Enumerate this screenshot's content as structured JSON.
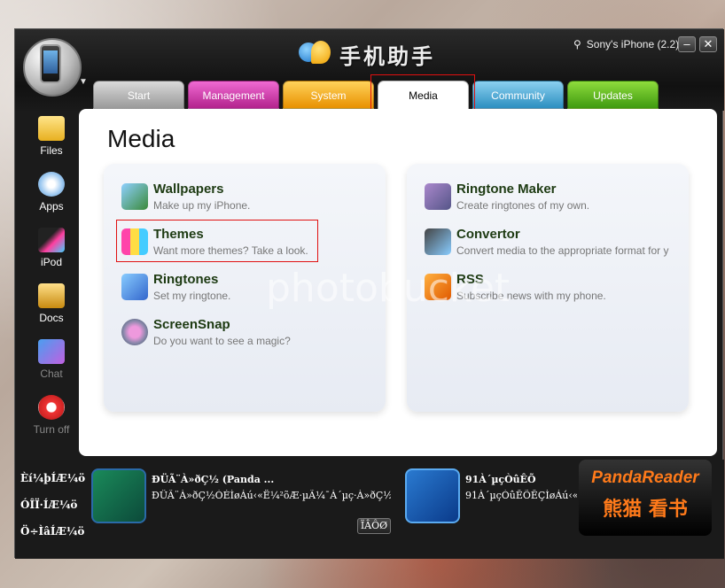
{
  "app": {
    "title": "手机助手"
  },
  "device": {
    "name": "Sony's iPhone (2.2)",
    "usb_icon": "usb-icon"
  },
  "window_buttons": {
    "minimize": "–",
    "close": "✕"
  },
  "tabs": [
    {
      "label": "Start",
      "color": "#bbbbbb"
    },
    {
      "label": "Management",
      "color": "#d63cb2"
    },
    {
      "label": "System",
      "color": "#f2ab1e"
    },
    {
      "label": "Media",
      "color": "#ffffff",
      "active": true
    },
    {
      "label": "Community",
      "color": "#44a6d4"
    },
    {
      "label": "Updates",
      "color": "#5fb81e"
    }
  ],
  "sidebar": {
    "items": [
      {
        "label": "Files",
        "icon": "folder-icon"
      },
      {
        "label": "Apps",
        "icon": "apps-cd-icon"
      },
      {
        "label": "iPod",
        "icon": "ipod-icon"
      },
      {
        "label": "Docs",
        "icon": "docs-icon"
      },
      {
        "label": "Chat",
        "icon": "chat-icon"
      },
      {
        "label": "Turn off",
        "icon": "power-icon"
      }
    ]
  },
  "main": {
    "title": "Media",
    "left_items": [
      {
        "name": "Wallpapers",
        "desc": "Make up my iPhone.",
        "icon": "wallpaper-icon"
      },
      {
        "name": "Themes",
        "desc": "Want more themes? Take a look.",
        "icon": "themes-icon"
      },
      {
        "name": "Ringtones",
        "desc": "Set my ringtone.",
        "icon": "ringtone-phone-icon"
      },
      {
        "name": "ScreenSnap",
        "desc": "Do you want to see a magic?",
        "icon": "screensnap-icon"
      }
    ],
    "right_items": [
      {
        "name": "Ringtone Maker",
        "desc": "Create ringtones of my own.",
        "icon": "music-note-icon"
      },
      {
        "name": "Convertor",
        "desc": "Convert media to the appropriate format for y",
        "icon": "convertor-icon"
      },
      {
        "name": "RSS",
        "desc": "Subscribe news with my phone.",
        "icon": "rss-icon"
      }
    ]
  },
  "watermark": "photobucket",
  "bottom": {
    "labels": [
      "Èí¼þÍÆ¼ö",
      "ÓÎÏ·ÍÆ¼ö",
      "Ö÷ÌâÍÆ¼ö"
    ],
    "promo1": {
      "title": "ÐÜÃ¨À»ðÇ½ (Panda ...",
      "desc": "ÐÜÃ¨À»ðÇ½ÒÉÌøÁú‹«Ë¼²õÆ·µÃ¼¯À´µç·À»ðÇ½°Í...",
      "button": "ÏÂÔØ"
    },
    "promo2": {
      "title": "91À´µçÒûÊÕ",
      "desc": "91À´µçÒûÊÕÊÇÌøÁú‹«Ë"
    },
    "brand": {
      "name": "PandaReader",
      "sub": "熊猫  看书"
    }
  }
}
